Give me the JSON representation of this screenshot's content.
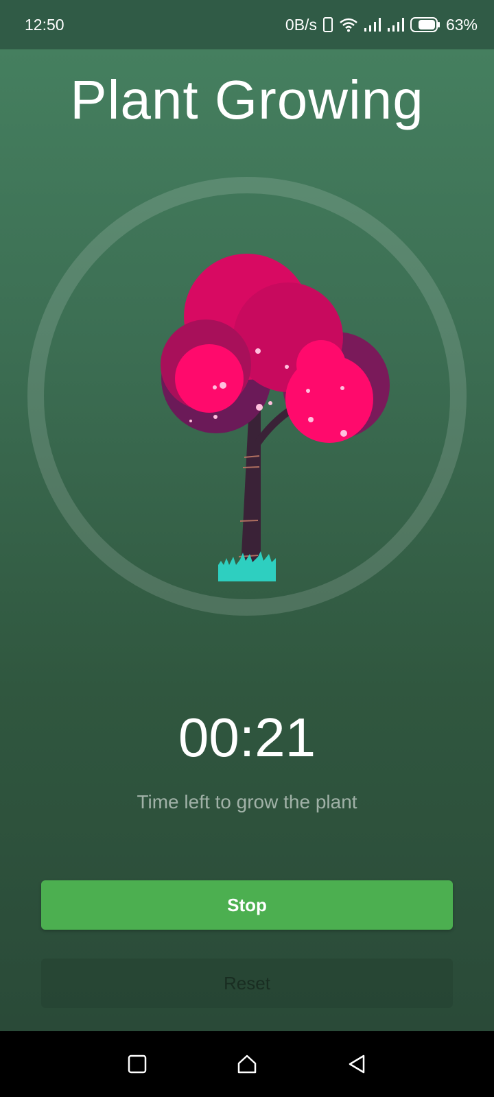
{
  "status_bar": {
    "time": "12:50",
    "net_speed": "0B/s",
    "battery": "63%"
  },
  "app": {
    "title": "Plant Growing",
    "timer": "00:21",
    "subtitle": "Time left to grow the plant",
    "stop_label": "Stop",
    "reset_label": "Reset"
  },
  "colors": {
    "accent": "#4caf50",
    "foliage": "#ff0a6c",
    "grass": "#2ecfc0"
  },
  "icons": {
    "recents": "square-icon",
    "home": "home-icon",
    "back": "back-triangle-icon"
  }
}
